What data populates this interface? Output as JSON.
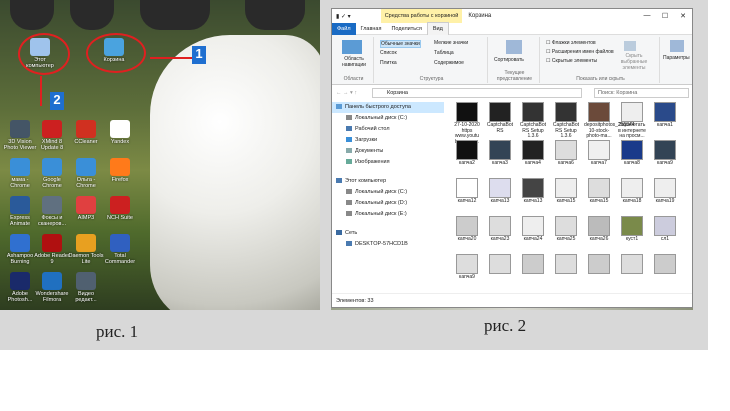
{
  "figure1": {
    "caption": "рис. 1",
    "icons": [
      {
        "name": "computer-icon",
        "label": "Этот компьютер"
      },
      {
        "name": "recycle-bin-icon",
        "label": "Корзина"
      },
      {
        "name": "3d-viewer-icon",
        "label": "3D Vision Photo Viewer"
      },
      {
        "name": "xmind-icon",
        "label": "XMind 8 Update 8"
      },
      {
        "name": "ccleaner-icon",
        "label": "CCleaner"
      },
      {
        "name": "yandex-icon",
        "label": "Yandex"
      },
      {
        "name": "chrome-icon",
        "label": "мама - Chrome"
      },
      {
        "name": "chrome-icon",
        "label": "Google Chrome"
      },
      {
        "name": "chrome-icon",
        "label": "Ольга - Chrome"
      },
      {
        "name": "firefox-icon",
        "label": "Firefox"
      },
      {
        "name": "express-animate-icon",
        "label": "Express Animate"
      },
      {
        "name": "photo-scanner-icon",
        "label": "Фоксы и сканеров..."
      },
      {
        "name": "aimp-icon",
        "label": "AIMP3"
      },
      {
        "name": "nch-suite-icon",
        "label": "NCH Suite"
      },
      {
        "name": "ashampoo-icon",
        "label": "Ashampoo Burning"
      },
      {
        "name": "adobe-reader-icon",
        "label": "Adobe Reader 9"
      },
      {
        "name": "daemon-tools-icon",
        "label": "Daemon Tools Lite"
      },
      {
        "name": "total-commander-icon",
        "label": "Total Commander"
      },
      {
        "name": "photoshop-icon",
        "label": "Adobe Photosh..."
      },
      {
        "name": "wondershare-icon",
        "label": "Wondershare Filmora"
      },
      {
        "name": "video-editor-icon",
        "label": "Видео редакт..."
      }
    ],
    "badge1": "1",
    "badge2": "2"
  },
  "figure2": {
    "caption": "рис. 2",
    "title_tab": "Средства работы с корзиной",
    "title": "Корзина",
    "ribbon_tabs": [
      "Файл",
      "Главная",
      "Поделиться",
      "Вид"
    ],
    "ribbon": {
      "pane_area": "Область навигации",
      "panes": "Области",
      "large_icons": "Обычные значки",
      "list": "Список",
      "tiles": "Плитка",
      "small_icons": "Мелкие значки",
      "table": "Таблица",
      "contents": "Содержимое",
      "structure": "Структура",
      "sort": "Сортировать",
      "current_view": "Текущее представление",
      "flags": "Флажки элементов",
      "extensions": "Расширения имен файлов",
      "hidden": "Скрытые элементы",
      "hide_selected": "Скрыть выбранные элементы",
      "show_hide": "Показать или скрыть",
      "parameters": "Параметры"
    },
    "address": "Корзина",
    "search_placeholder": "Поиск: Корзина",
    "nav": [
      {
        "label": "Панель быстрого доступа",
        "sel": true
      },
      {
        "label": "Локальный диск (C:)"
      },
      {
        "label": "Рабочий стол"
      },
      {
        "label": "Загрузки"
      },
      {
        "label": "Документы"
      },
      {
        "label": "Изображения"
      },
      {
        "label": "Этот компьютер"
      },
      {
        "label": "Локальный диск (C:)"
      },
      {
        "label": "Локальный диск (D:)"
      },
      {
        "label": "Локальный диск (E:)"
      },
      {
        "label": "Сеть"
      },
      {
        "label": "DESKTOP-57HCD1B"
      }
    ],
    "files": [
      "27-10-2020 https www.youtu becom w...",
      "CaptchaBot RS",
      "CaptchaBot RS Setup 1.3.6",
      "CaptchaBot RS Setup 1.3.6",
      "depositphotos_255844 10-stock-photo-ma...",
      "Заработать в интернете на просм...",
      "капча1",
      "капча2",
      "капча3",
      "капча4",
      "капча6",
      "капча7",
      "капча8",
      "капча9",
      "капча12",
      "капча13",
      "капча13",
      "капча15",
      "капча15",
      "капча18",
      "капча19",
      "капча20",
      "капча23",
      "капча24",
      "капча25",
      "капча26",
      "куст1",
      "сл1",
      "капча9",
      "",
      "",
      "",
      "",
      "",
      ""
    ],
    "status": "Элементов: 33"
  }
}
